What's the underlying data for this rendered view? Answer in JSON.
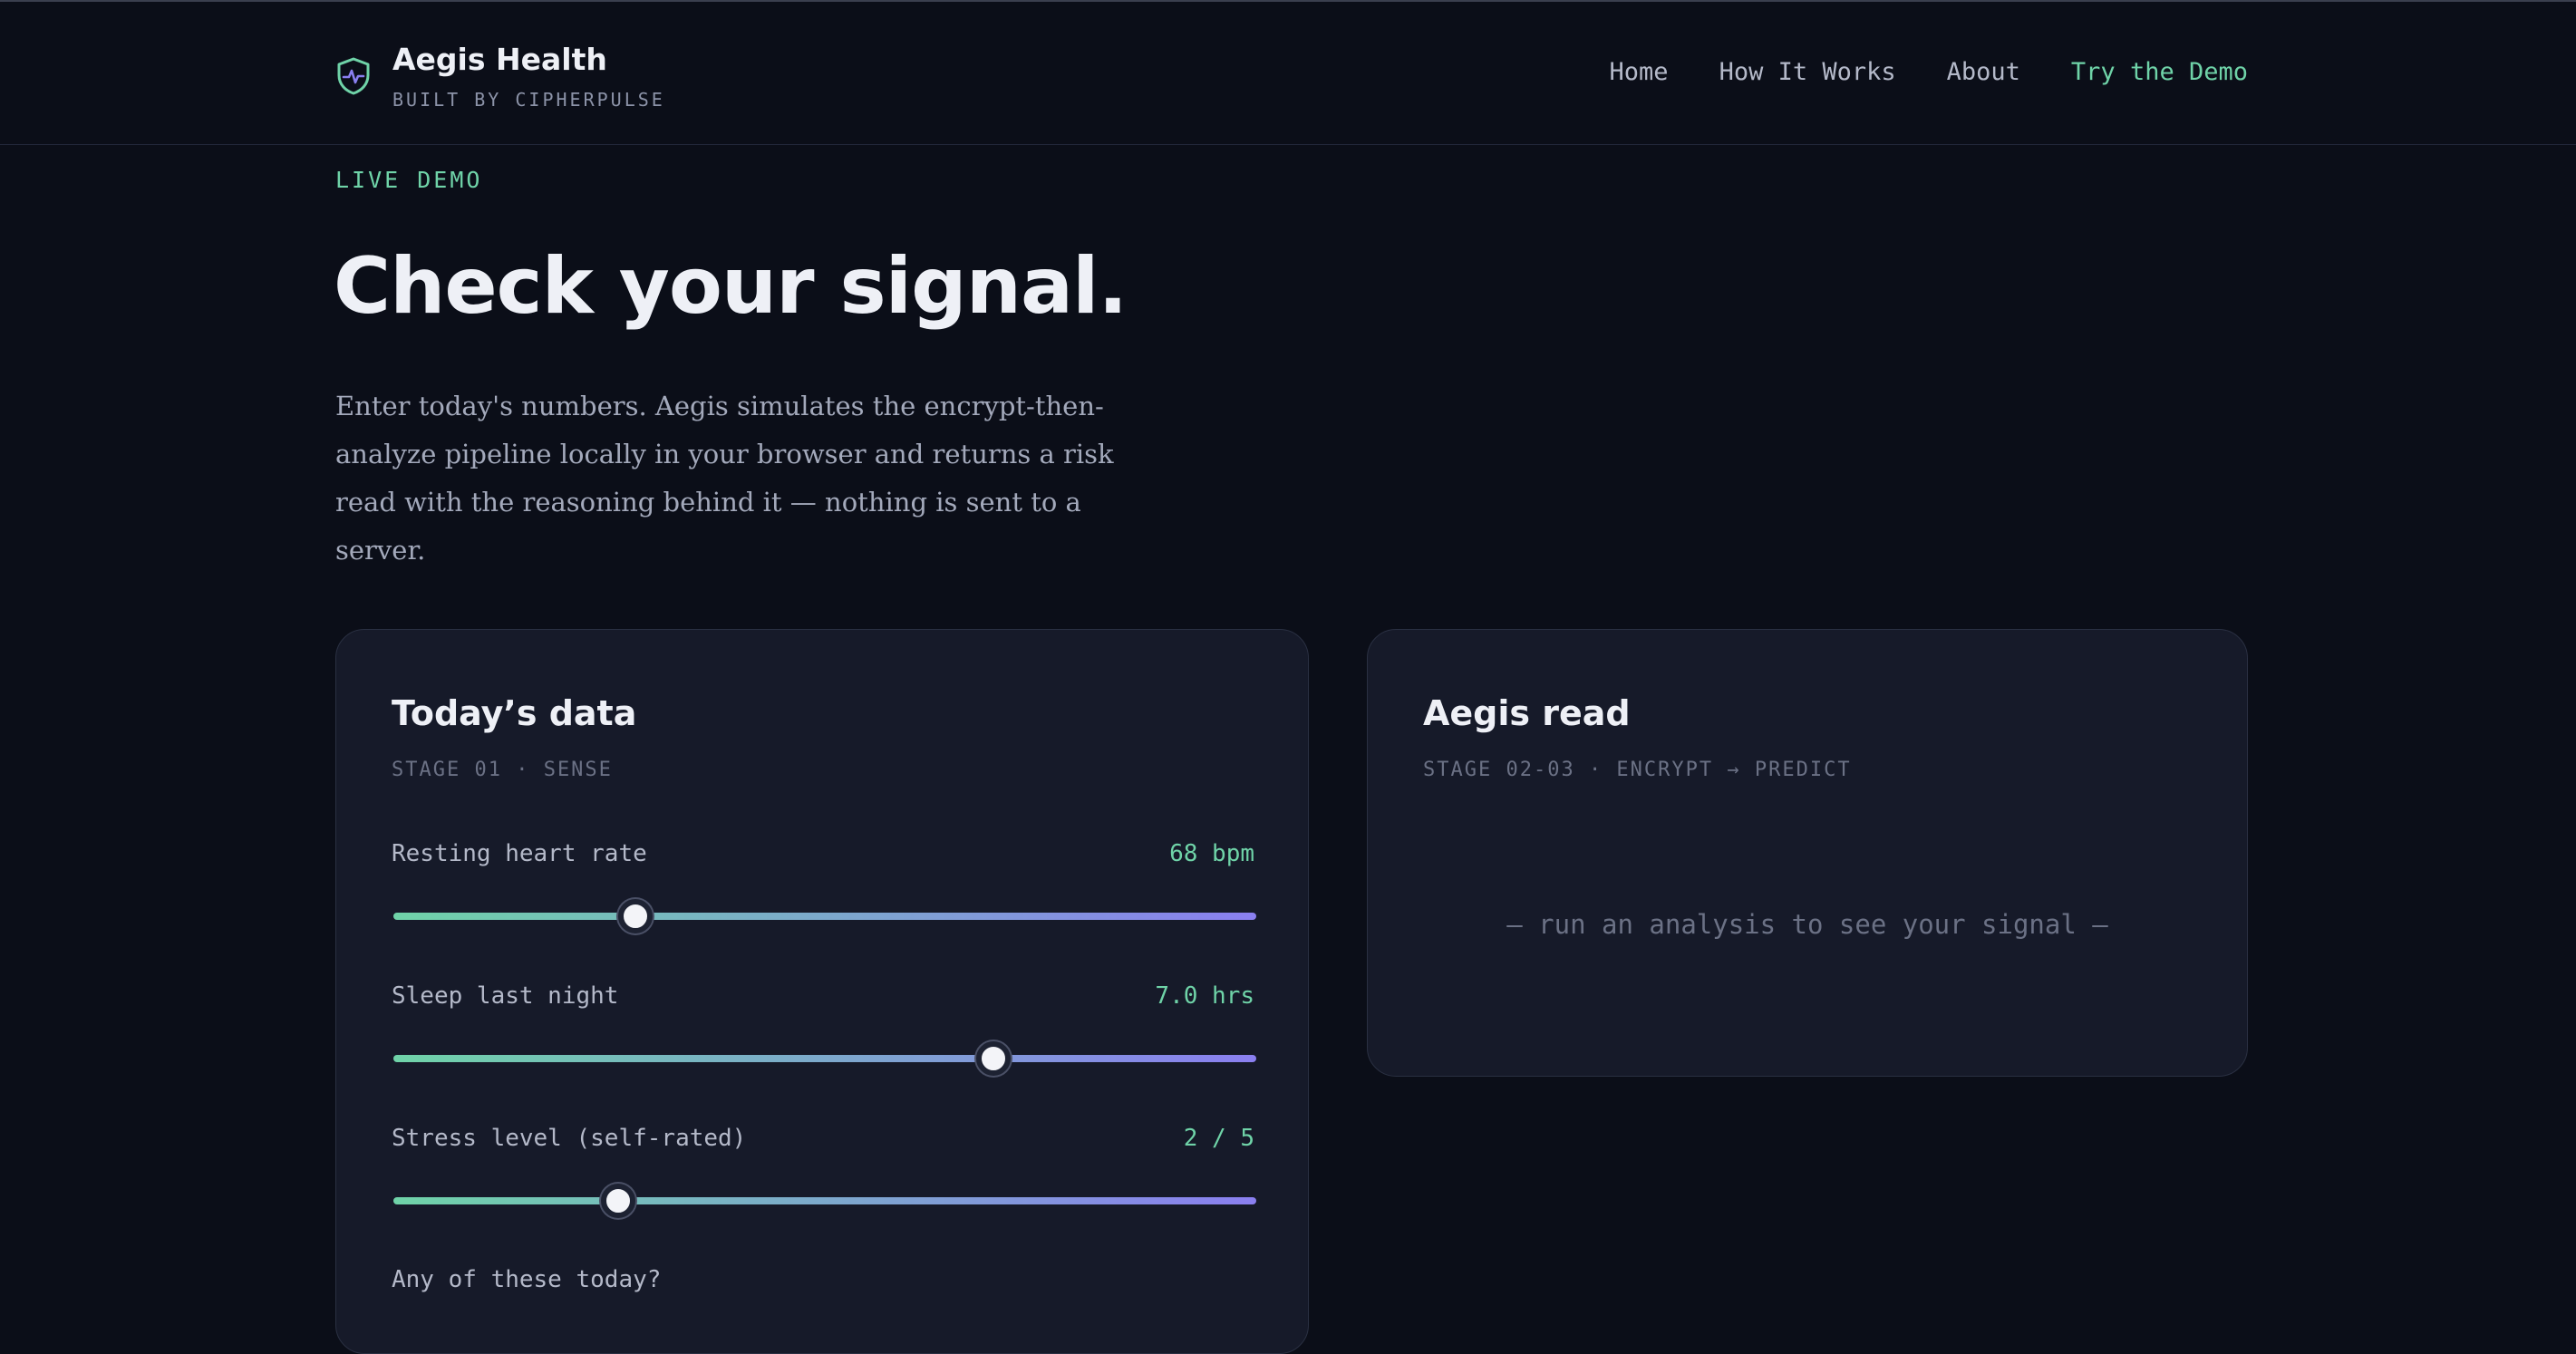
{
  "nav": {
    "brand_name": "Aegis Health",
    "brand_sub": "BUILT BY CIPHERPULSE",
    "brand_icon": "shield-pulse-icon",
    "links": [
      {
        "label": "Home"
      },
      {
        "label": "How It Works"
      },
      {
        "label": "About"
      },
      {
        "label": "Try the Demo",
        "accent": true
      }
    ]
  },
  "hero": {
    "eyebrow": "LIVE DEMO",
    "title": "Check your signal.",
    "description": "Enter today's numbers. Aegis simulates the encrypt-then-analyze pipeline locally in your browser and returns a risk read with the reasoning behind it — nothing is sent to a server."
  },
  "input_card": {
    "title": "Today’s data",
    "stage": "STAGE 01 · SENSE",
    "fields": [
      {
        "label": "Resting heart rate",
        "value": "68 bpm",
        "fraction": 0.28
      },
      {
        "label": "Sleep last night",
        "value": "7.0 hrs",
        "fraction": 0.695
      },
      {
        "label": "Stress level (self-rated)",
        "value": "2 / 5",
        "fraction": 0.26
      }
    ],
    "next_label": "Any of these today?"
  },
  "result_card": {
    "title": "Aegis read",
    "stage": "STAGE 02-03 · ENCRYPT → PREDICT",
    "empty_message": "— run an analysis to see your signal —"
  },
  "colors": {
    "background": "#0b0e18",
    "card": "#161a29",
    "accent_green": "#6fd3a8",
    "accent_violet": "#8a7ff0"
  }
}
